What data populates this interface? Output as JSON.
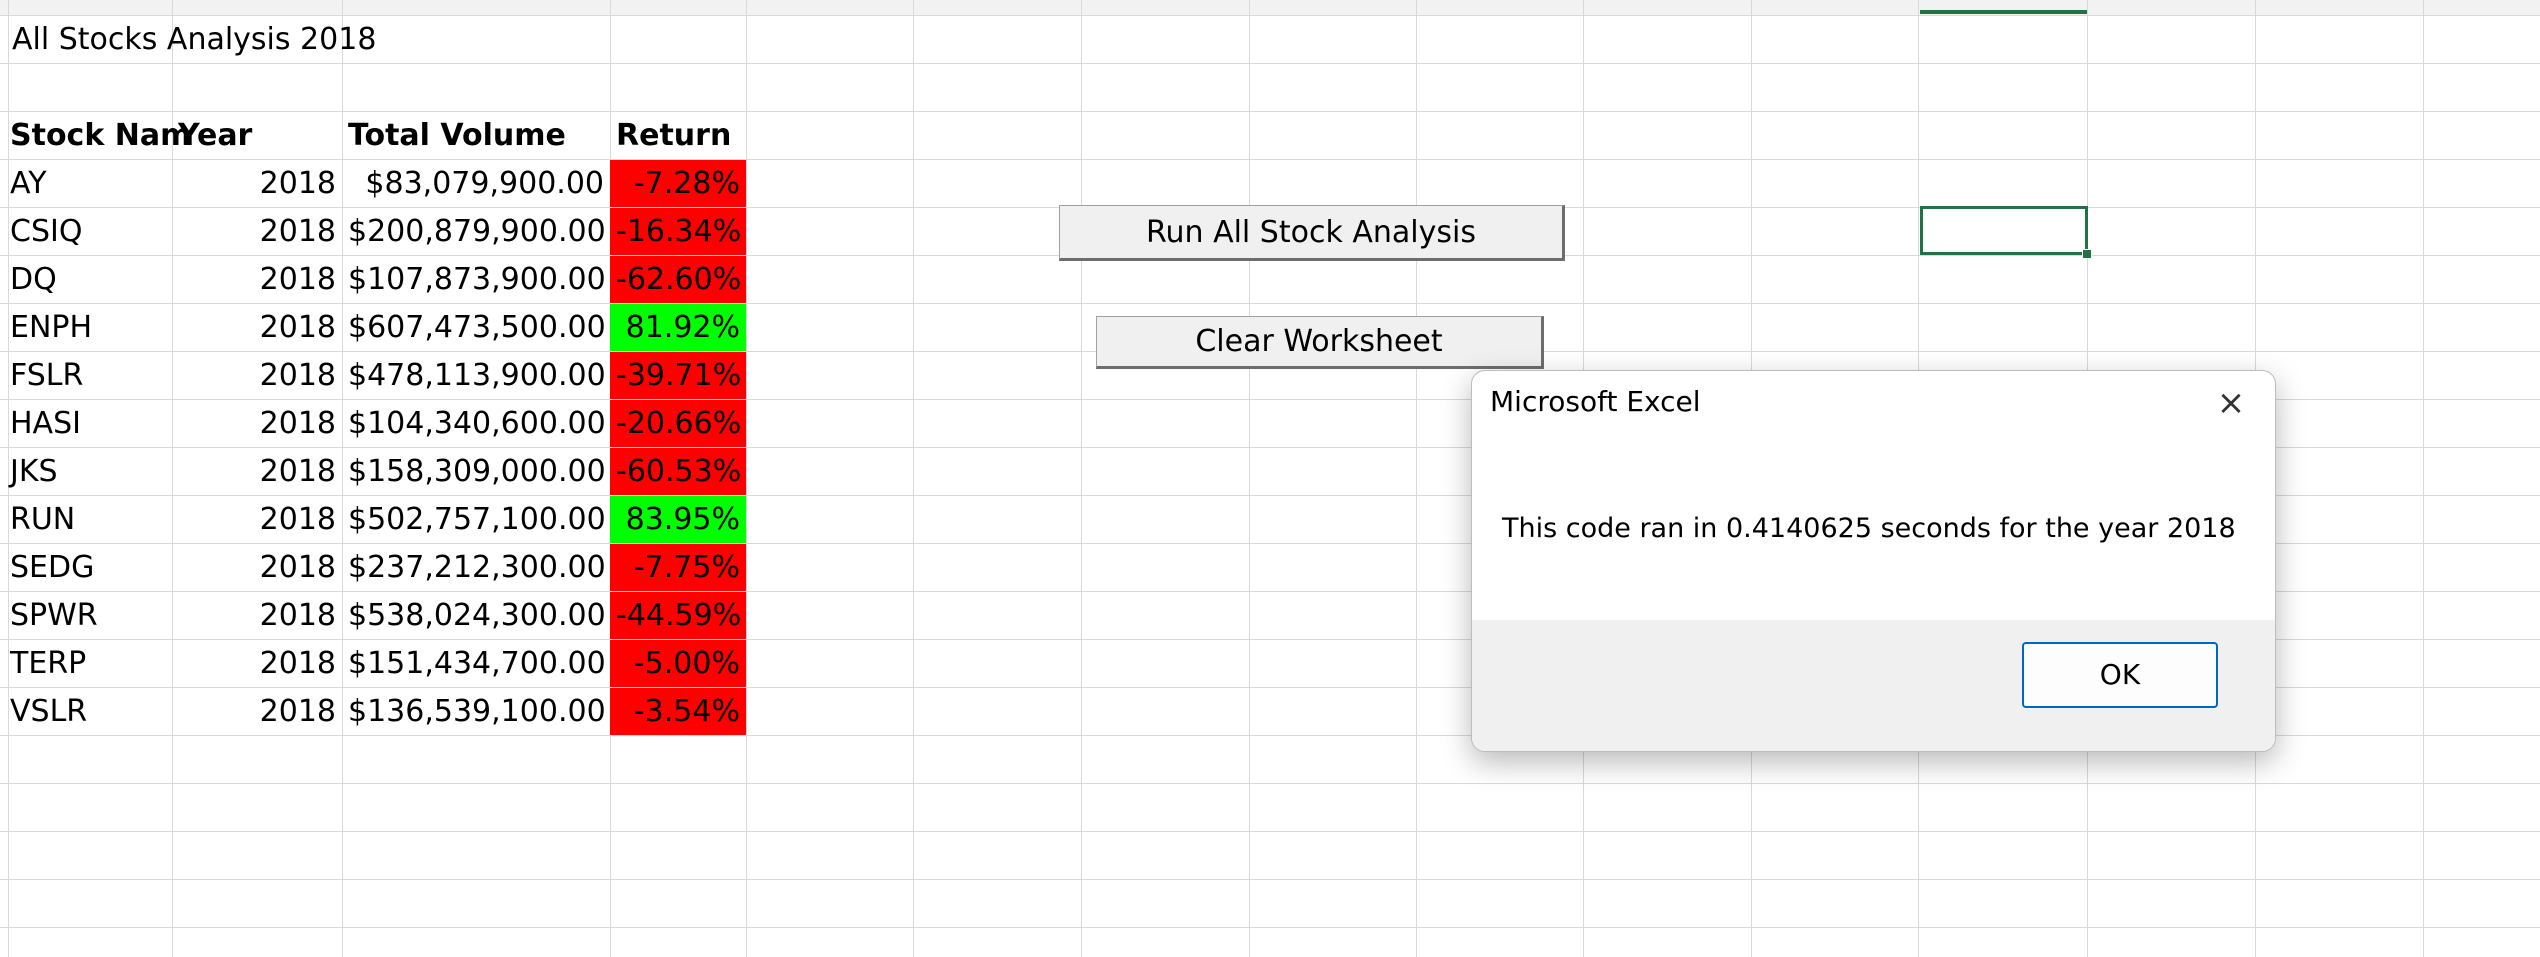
{
  "sheet": {
    "title": "All Stocks Analysis  2018",
    "headers": {
      "stock": "Stock Nam",
      "year": "Year",
      "volume": "Total Volume",
      "return": "Return"
    },
    "rows": [
      {
        "ticker": "AY",
        "year": "2018",
        "volume": "$83,079,900.00",
        "return": "-7.28%",
        "status": "negative"
      },
      {
        "ticker": "CSIQ",
        "year": "2018",
        "volume": "$200,879,900.00",
        "return": "-16.34%",
        "status": "negative"
      },
      {
        "ticker": "DQ",
        "year": "2018",
        "volume": "$107,873,900.00",
        "return": "-62.60%",
        "status": "negative"
      },
      {
        "ticker": "ENPH",
        "year": "2018",
        "volume": "$607,473,500.00",
        "return": "81.92%",
        "status": "positive"
      },
      {
        "ticker": "FSLR",
        "year": "2018",
        "volume": "$478,113,900.00",
        "return": "-39.71%",
        "status": "negative"
      },
      {
        "ticker": "HASI",
        "year": "2018",
        "volume": "$104,340,600.00",
        "return": "-20.66%",
        "status": "negative"
      },
      {
        "ticker": "JKS",
        "year": "2018",
        "volume": "$158,309,000.00",
        "return": "-60.53%",
        "status": "negative"
      },
      {
        "ticker": "RUN",
        "year": "2018",
        "volume": "$502,757,100.00",
        "return": "83.95%",
        "status": "positive"
      },
      {
        "ticker": "SEDG",
        "year": "2018",
        "volume": "$237,212,300.00",
        "return": "-7.75%",
        "status": "negative"
      },
      {
        "ticker": "SPWR",
        "year": "2018",
        "volume": "$538,024,300.00",
        "return": "-44.59%",
        "status": "negative"
      },
      {
        "ticker": "TERP",
        "year": "2018",
        "volume": "$151,434,700.00",
        "return": "-5.00%",
        "status": "negative"
      },
      {
        "ticker": "VSLR",
        "year": "2018",
        "volume": "$136,539,100.00",
        "return": "-3.54%",
        "status": "negative"
      }
    ],
    "colors": {
      "negative": "#ff0000",
      "positive": "#00ff00",
      "selection": "#217346"
    }
  },
  "buttons": {
    "run_all": "Run All Stock Analysis",
    "clear": "Clear Worksheet"
  },
  "dialog": {
    "title": "Microsoft Excel",
    "close_icon": "×",
    "message": "This code ran in 0.4140625 seconds for the year  2018",
    "ok_label": "OK"
  }
}
